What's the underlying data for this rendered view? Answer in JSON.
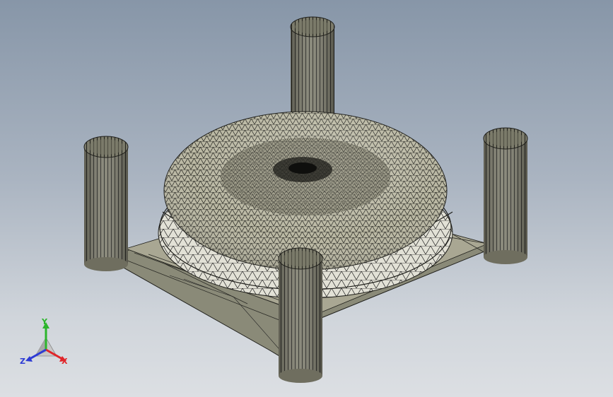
{
  "viewport": {
    "background_top": "#8796a8",
    "background_bottom": "#dcdfe3",
    "model": {
      "description_icon": "cad-mesh-model",
      "mesh_color": "#1e1e1a",
      "face_color": "#b6b49e"
    }
  },
  "triad": {
    "x_label": "X",
    "y_label": "Y",
    "z_label": "Z",
    "x_color": "#e0262a",
    "y_color": "#2cb52c",
    "z_color": "#2d3bd4"
  }
}
